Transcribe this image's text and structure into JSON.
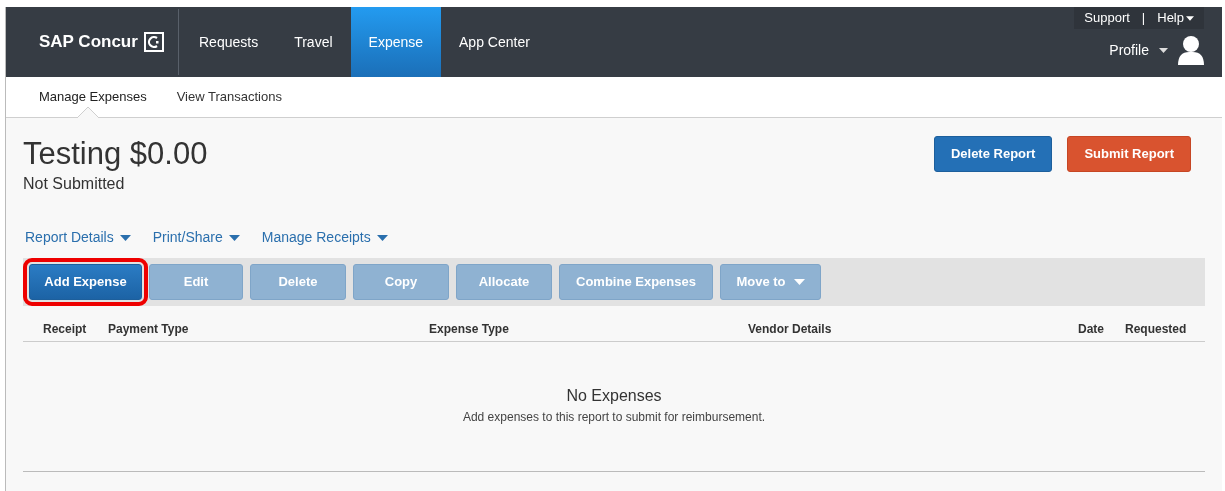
{
  "brand": {
    "name": "SAP Concur"
  },
  "nav": [
    {
      "label": "Requests",
      "selected": false
    },
    {
      "label": "Travel",
      "selected": false
    },
    {
      "label": "Expense",
      "selected": true
    },
    {
      "label": "App Center",
      "selected": false
    }
  ],
  "utility_links": [
    {
      "label": "Support",
      "has_menu": false
    },
    {
      "label": "Help",
      "has_menu": true
    }
  ],
  "separator": "|",
  "profile": {
    "label": "Profile"
  },
  "subnav": [
    {
      "label": "Manage Expenses",
      "selected": true
    },
    {
      "label": "View Transactions",
      "selected": false
    }
  ],
  "report": {
    "title": "Testing $0.00",
    "status": "Not Submitted"
  },
  "report_buttons": [
    {
      "label": "Delete Report",
      "kind": "primary"
    },
    {
      "label": "Submit Report",
      "kind": "danger"
    }
  ],
  "report_menus": [
    "Report Details",
    "Print/Share",
    "Manage Receipts"
  ],
  "toolbar": [
    {
      "label": "Add Expense",
      "disabled": false,
      "highlighted": true,
      "has_menu": false
    },
    {
      "label": "Edit",
      "disabled": true,
      "highlighted": false,
      "has_menu": false
    },
    {
      "label": "Delete",
      "disabled": true,
      "highlighted": false,
      "has_menu": false
    },
    {
      "label": "Copy",
      "disabled": true,
      "highlighted": false,
      "has_menu": false
    },
    {
      "label": "Allocate",
      "disabled": true,
      "highlighted": false,
      "has_menu": false
    },
    {
      "label": "Combine Expenses",
      "disabled": true,
      "highlighted": false,
      "has_menu": false
    },
    {
      "label": "Move to",
      "disabled": true,
      "highlighted": false,
      "has_menu": true
    }
  ],
  "table": {
    "columns": [
      "Receipt",
      "Payment Type",
      "Expense Type",
      "Vendor Details",
      "Date",
      "Requested"
    ],
    "empty_title": "No Expenses",
    "empty_message": "Add expenses to this report to submit for reimbursement."
  }
}
